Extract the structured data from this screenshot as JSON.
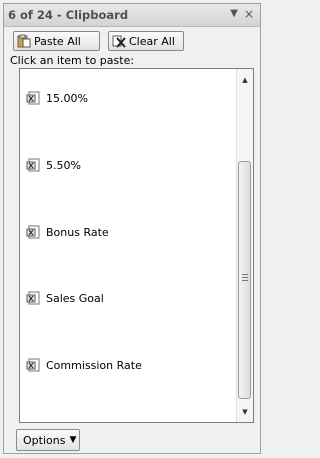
{
  "pane": {
    "title": "6 of 24 - Clipboard",
    "menu_icon": "dropdown-arrow-icon",
    "close_glyph": "×"
  },
  "toolbar": {
    "paste_all_label": "Paste All",
    "clear_all_label": "Clear All"
  },
  "instruction": "Click an item to paste:",
  "items": [
    {
      "label": "15.00%",
      "icon": "excel-clip-icon"
    },
    {
      "label": "5.50%",
      "icon": "excel-clip-icon"
    },
    {
      "label": "Bonus Rate",
      "icon": "excel-clip-icon"
    },
    {
      "label": "Sales Goal",
      "icon": "excel-clip-icon"
    },
    {
      "label": "Commission Rate",
      "icon": "excel-clip-icon"
    }
  ],
  "footer": {
    "options_label": "Options"
  }
}
